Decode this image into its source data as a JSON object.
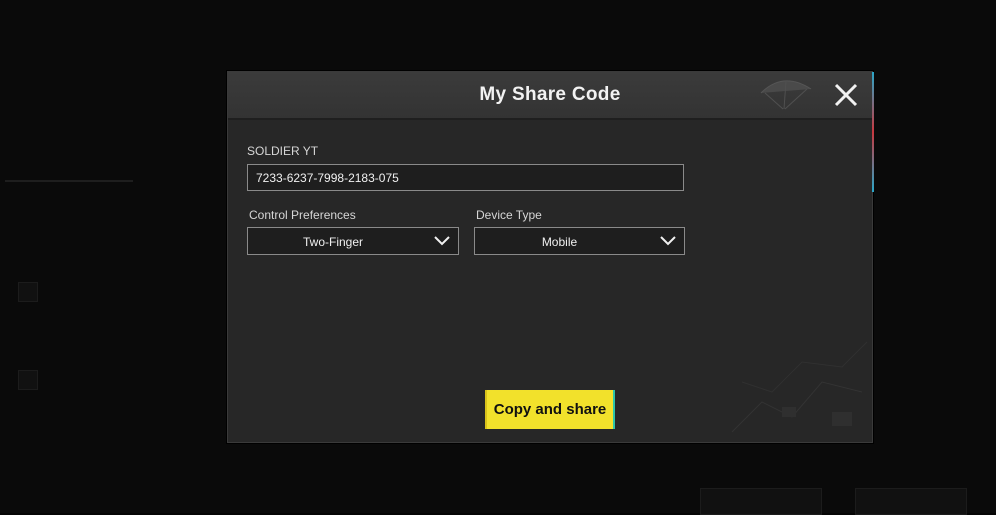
{
  "dialog": {
    "title": "My Share Code",
    "player_name": "SOLDIER YT",
    "share_code": "7233-6237-7998-2183-075",
    "control_preferences": {
      "label": "Control Preferences",
      "selected": "Two-Finger"
    },
    "device_type": {
      "label": "Device Type",
      "selected": "Mobile"
    },
    "copy_button_label": "Copy and share",
    "icons": {
      "close": "close-icon",
      "dropdown": "chevron-down-icon"
    }
  },
  "colors": {
    "accent_button": "#f2e12b",
    "modal_background": "#272727",
    "header_background": "#3b3b3b",
    "field_border": "#8a8a8a"
  }
}
